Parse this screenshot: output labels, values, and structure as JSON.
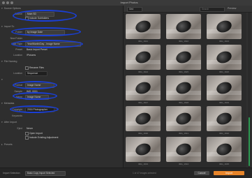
{
  "window": {
    "title": "Import Photos"
  },
  "toolbar": {
    "view_label": "Grid",
    "search_placeholder": "Search",
    "preview_label": "Preview"
  },
  "left_panel": {
    "sections": {
      "source": "Source Options",
      "import": "Import To",
      "file_naming": "File Naming",
      "metadata": "Metadata",
      "after_import": "After Import",
      "presets": "Presets"
    },
    "source": {
      "label": "Source",
      "value": "Main SD",
      "include_subfolders": "Include Subfolders"
    },
    "import_to": {
      "folder_label": "Folder",
      "folder_value": "by Image Date",
      "new_folder_label": "New Folder",
      "date_label": "Date Style",
      "date_value": "Year/Month/Day - Image Name",
      "preset_label": "Preset",
      "preset_value": "Basic Import Preset",
      "location_label": "Location",
      "location_value": "/Pictures"
    },
    "file_naming": {
      "rename_label": "Rename Files",
      "location_label": "Location",
      "location_value": "Sequence",
      "format_label": "Format",
      "format_value": "Image Name",
      "sample_label": "Sample",
      "sample_value": "IMG_0001",
      "name_label": "Name",
      "name_value": "Image Name"
    },
    "metadata": {
      "copyright_label": "Copyright",
      "copyright_value": "2016 Photographer",
      "keywords_label": "Keywords"
    },
    "after_import": {
      "eject_label": "Eject",
      "eject_value": "Never",
      "open_label": "Open Import",
      "include_label": "Include Existing Adjustment"
    }
  },
  "grid": {
    "thumbs": [
      {
        "caption": "IMG_1621"
      },
      {
        "caption": "IMG_1622"
      },
      {
        "caption": "IMG_1623"
      },
      {
        "caption": "IMG_1624"
      },
      {
        "caption": "IMG_1625"
      },
      {
        "caption": "IMG_1626"
      },
      {
        "caption": "IMG_1627"
      },
      {
        "caption": "IMG_1628"
      },
      {
        "caption": "IMG_1629"
      },
      {
        "caption": "IMG_1630"
      },
      {
        "caption": "IMG_1631"
      },
      {
        "caption": "IMG_1632"
      },
      {
        "caption": "IMG_1633"
      },
      {
        "caption": "IMG_1634"
      },
      {
        "caption": "IMG_1635"
      }
    ]
  },
  "bottom": {
    "import_selection_label": "Import Selection",
    "import_selection_value": "Basic Copy Import Selected",
    "count_text": "1 of 47 images selected",
    "cancel": "Cancel",
    "import": "Import"
  },
  "colors": {
    "highlight_oval": "#1a3fd6",
    "import_button": "#e8852a",
    "scrollbar": "#2e9a52"
  }
}
